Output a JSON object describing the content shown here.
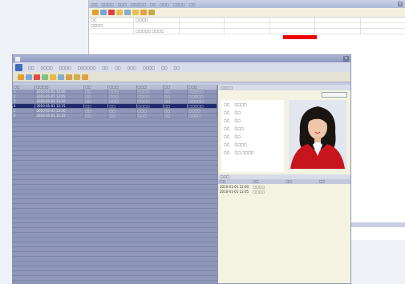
{
  "background_window": {
    "menu": [
      "□□",
      "□□□□",
      "□□□",
      "□□□□□",
      "□□",
      "□□□",
      "□□□□",
      "□□"
    ],
    "grid": [
      [
        "□□",
        "□□□□",
        "",
        "",
        "",
        "",
        ""
      ],
      [
        "□□□□",
        "",
        "",
        "",
        "",
        "",
        ""
      ],
      [
        "",
        "□□□□□ □□□□",
        "",
        "",
        "",
        "",
        ""
      ],
      [
        "",
        "",
        "",
        "",
        "",
        "",
        ""
      ]
    ],
    "red_bar_color": "#e00000"
  },
  "main_window": {
    "title": "",
    "menu": [
      "□□",
      "□□□□",
      "□□□□",
      "□□□□□□",
      "□□",
      "□□",
      "□□□",
      "□□□□",
      "□□",
      "□□"
    ],
    "table": {
      "columns": [
        "□□",
        "□□□□",
        "□□",
        "□□□",
        "□□□",
        "□□",
        "□□□"
      ],
      "rows": [
        [
          "1",
          "2010-01-01 12:00",
          "□□",
          "□□□",
          "□□□□",
          "□□",
          "□□□□□"
        ],
        [
          "2",
          "2010-01-01 12:05",
          "□□",
          "□□□",
          "□□□□",
          "□□",
          "□□□□□"
        ],
        [
          "3",
          "2010-01-01 12:10",
          "□□",
          "□□□",
          "□□□□",
          "□□",
          "□□□□□"
        ],
        [
          "4",
          "2010-01-01 12:15",
          "□□",
          "□□",
          "□□□□",
          "□□",
          "□□□□□"
        ],
        [
          "5",
          "2010-01-01 12:20",
          "□□",
          "□□",
          "□□□",
          "□□",
          "□□□□"
        ],
        [
          "6",
          "2010-01-01 12:25",
          "□□",
          "□□",
          "□□□",
          "□□",
          "□□□□"
        ]
      ],
      "selected_row": 3
    },
    "panel": {
      "header": "□□□□",
      "button": "",
      "info": [
        {
          "k": "□□",
          "v": "□□□□"
        },
        {
          "k": "□□",
          "v": "□□"
        },
        {
          "k": "□□",
          "v": "□□"
        },
        {
          "k": "□□",
          "v": "□□□"
        },
        {
          "k": "□□",
          "v": "□□"
        },
        {
          "k": "□□",
          "v": "□□□□"
        },
        {
          "k": "□□",
          "v": "□□ □□□□"
        }
      ],
      "sub_header": "□□□",
      "sub_columns": [
        "□□",
        "□□",
        "□□",
        "□□"
      ],
      "sub_rows": [
        [
          "2010-01-01 12:00",
          "□□□□",
          "",
          ""
        ],
        [
          "2010-01-01 12:05",
          "□□□□",
          "",
          ""
        ]
      ]
    }
  }
}
